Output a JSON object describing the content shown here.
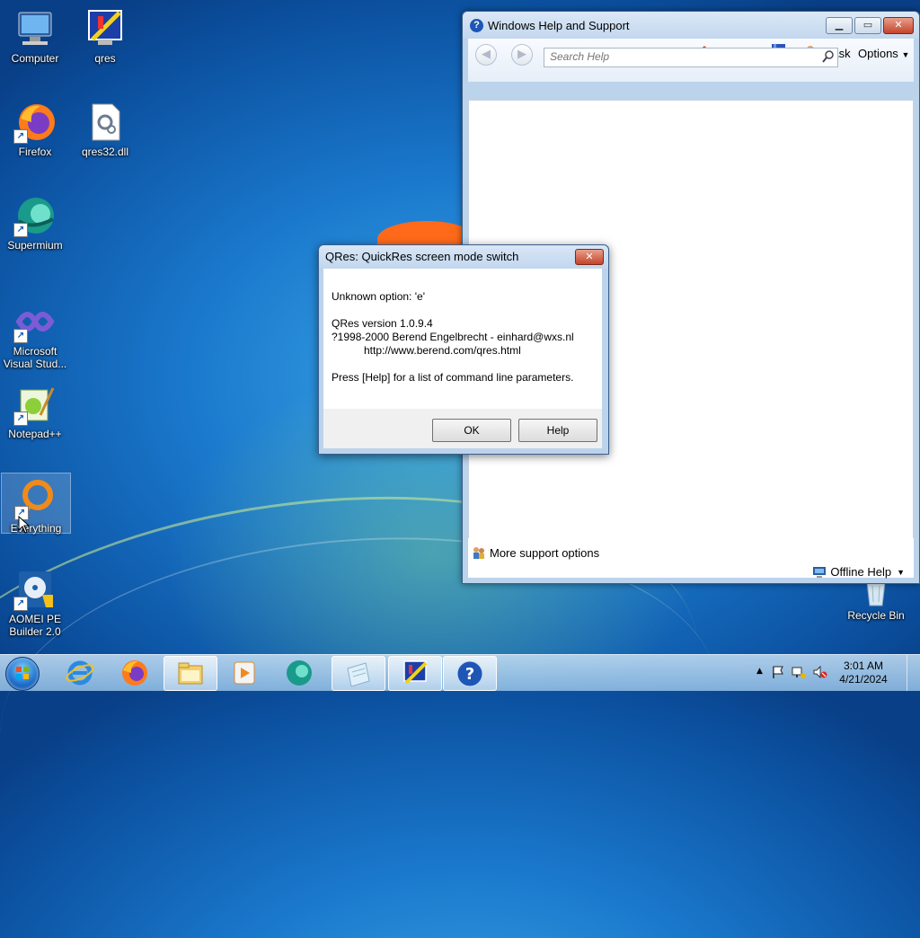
{
  "desktop": {
    "icons": [
      {
        "label": "Computer"
      },
      {
        "label": "qres"
      },
      {
        "label": "Firefox"
      },
      {
        "label": "qres32.dll"
      },
      {
        "label": "Supermium"
      },
      {
        "label": "Microsoft Visual Stud..."
      },
      {
        "label": "Notepad++"
      },
      {
        "label": "Everything"
      },
      {
        "label": "AOMEI PE Builder 2.0"
      },
      {
        "label": "Recycle Bin"
      }
    ]
  },
  "help_window": {
    "title": "Windows Help and Support",
    "toolbar": {
      "ask_label": "Ask",
      "options_label": "Options"
    },
    "search": {
      "placeholder": "Search Help"
    },
    "footer": {
      "more_support": "More support options",
      "offline_help": "Offline Help"
    }
  },
  "qres_dialog": {
    "title": "QRes: QuickRes screen mode switch",
    "lines": {
      "error": "Unknown option: 'e'",
      "version": "QRes version 1.0.9.4",
      "copyright": "?1998-2000 Berend Engelbrecht - einhard@wxs.nl",
      "url": "http://www.berend.com/qres.html",
      "hint": "Press [Help] for a list of command line parameters."
    },
    "buttons": {
      "ok": "OK",
      "help": "Help"
    }
  },
  "taskbar": {
    "apps": [
      "internet-explorer",
      "firefox",
      "file-explorer",
      "media-player",
      "supermium",
      "notepad",
      "qres",
      "help-and-support"
    ],
    "clock": {
      "time": "3:01 AM",
      "date": "4/21/2024"
    }
  },
  "colors": {
    "accent": "#1e56b6",
    "close_red": "#c4442a",
    "desktop_blue": "#1a78cc"
  }
}
